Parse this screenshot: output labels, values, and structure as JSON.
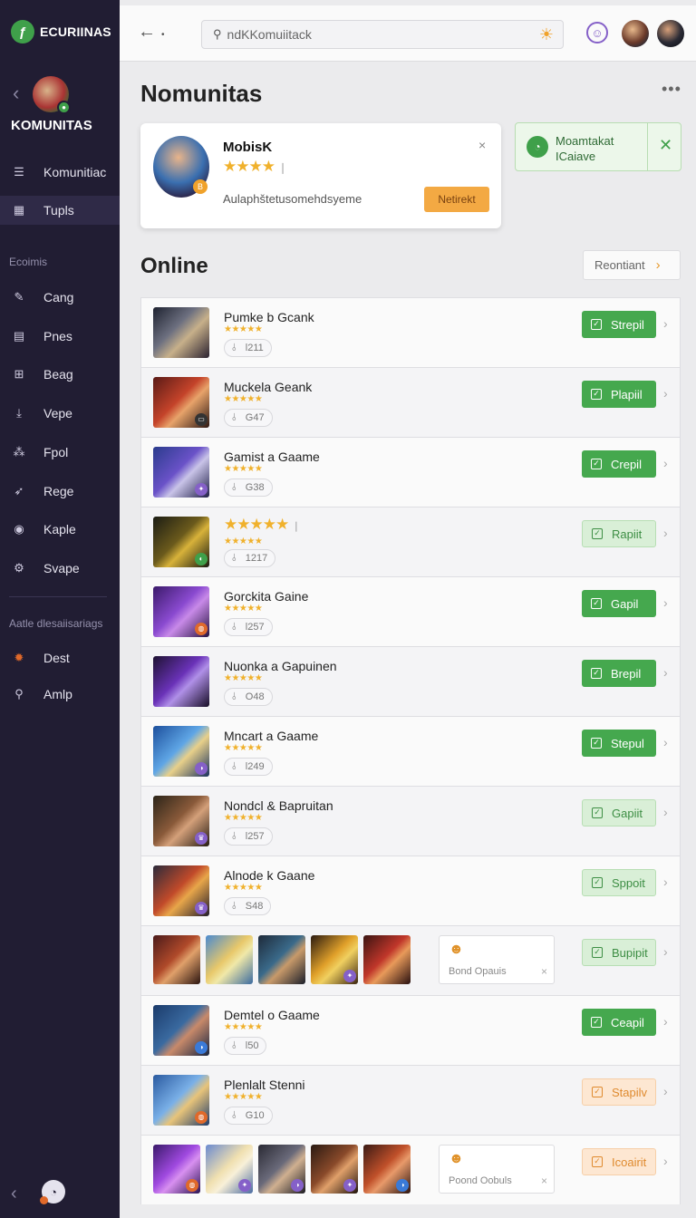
{
  "brand": {
    "logo_glyph": "ƒ",
    "name": "ECURIINAS"
  },
  "community": {
    "title": "KOMUNITAS"
  },
  "sidebar": {
    "items_top": [
      {
        "label": "Komunitiac",
        "icon": "list-icon",
        "glyph": "☰"
      },
      {
        "label": "Tupls",
        "icon": "grid-icon",
        "glyph": "▦",
        "active": true
      }
    ],
    "section1": "Ecoimis",
    "items_mid": [
      {
        "label": "Cang",
        "icon": "sword-icon",
        "glyph": "✎"
      },
      {
        "label": "Pnes",
        "icon": "doc-icon",
        "glyph": "▤"
      },
      {
        "label": "Beag",
        "icon": "box-icon",
        "glyph": "⊞"
      },
      {
        "label": "Vepe",
        "icon": "download-icon",
        "glyph": "⤓"
      },
      {
        "label": "Fpol",
        "icon": "group-icon",
        "glyph": "⁂"
      },
      {
        "label": "Rege",
        "icon": "wing-icon",
        "glyph": "➶"
      },
      {
        "label": "Kaple",
        "icon": "circle-icon",
        "glyph": "◉"
      },
      {
        "label": "Svape",
        "icon": "gear-icon",
        "glyph": "⚙"
      }
    ],
    "section2": "Aatle dlesaiisariags",
    "items_bottom": [
      {
        "label": "Dest",
        "icon": "orange-gear-icon",
        "glyph": "✹"
      },
      {
        "label": "Amlp",
        "icon": "search-icon",
        "glyph": "⚲"
      }
    ]
  },
  "topbar": {
    "search_value": "ndKKomuiitack",
    "search_glyph": "⚲",
    "sun_glyph": "☀",
    "smile_glyph": "☺"
  },
  "page": {
    "title": "Nomunitas",
    "more": "•••"
  },
  "featured": {
    "name": "MobisK",
    "stars": "★★★★",
    "half": "❘",
    "badge": "B",
    "desc": "Aulaphštetusomehdsyeme",
    "button": "Netirekt",
    "close": "×"
  },
  "toast": {
    "text": "Moamtakat ICaiave",
    "glyph": "◔",
    "close": "✕"
  },
  "online": {
    "title": "Online",
    "recent_button": "Reontiant",
    "recent_chev": "›"
  },
  "colors": {
    "green": "#45a84e",
    "orange": "#f3a943",
    "sidebar": "#211d33"
  },
  "rows": [
    {
      "type": "single",
      "title": "Pumke b Gcank",
      "stars": "★★★★★",
      "count": "Ɩ211",
      "action": "Strepil",
      "style": "green",
      "thumb": "linear-gradient(135deg,#1e2230,#6d7080 40%,#c7b08a 60%,#2a2230)",
      "badge": ""
    },
    {
      "type": "single",
      "title": "Muckela Geank",
      "stars": "★★★★★",
      "count": "G47",
      "action": "Plapiil",
      "style": "green",
      "thumb": "linear-gradient(135deg,#5a1a16,#c4432a 45%,#e8a36a 60%,#2b1612)",
      "badge": "▭",
      "badgeColor": "#333"
    },
    {
      "type": "single",
      "title": "Gamist a Gaame",
      "stars": "★★★★★",
      "count": "G38",
      "action": "Crepil",
      "style": "green",
      "thumb": "linear-gradient(135deg,#2a3b8c,#6a52c8 45%,#c9c4e8 60%,#1d1c45)",
      "badge": "✦",
      "badgeColor": "#8560c8"
    },
    {
      "type": "single",
      "big": true,
      "title": "",
      "stars": "★★★★★",
      "half": "❘",
      "count": "1217",
      "action": "Rapiit",
      "style": "light",
      "thumb": "linear-gradient(135deg,#1b1c14,#6b5a1c 45%,#d8b23a 60%,#15170f)",
      "badge": "◐",
      "badgeColor": "#3fa04a",
      "stars2": "★★★★★"
    },
    {
      "type": "single",
      "title": "Gorckita Gaine",
      "stars": "★★★★★",
      "count": "Ɩ257",
      "action": "Gapil",
      "style": "green",
      "thumb": "linear-gradient(135deg,#3b1a6a,#8a4ad0 45%,#c88ae8 60%,#24123e)",
      "badge": "◍",
      "badgeColor": "#e0692a"
    },
    {
      "type": "single",
      "title": "Nuonka a Gapuinen",
      "stars": "★★★★★",
      "count": "O48",
      "action": "Brepil",
      "style": "green",
      "thumb": "linear-gradient(135deg,#1e1232,#6a32b8 45%,#b090e8 60%,#170d26)",
      "badge": "",
      "badgeColor": ""
    },
    {
      "type": "single",
      "title": "Mncart a Gaame",
      "stars": "★★★★★",
      "count": "Ɩ249",
      "action": "Stepul",
      "style": "green",
      "thumb": "linear-gradient(135deg,#1c4f9c,#5fa6e6 45%,#e8d08a 60%,#17305e)",
      "badge": "◑",
      "badgeColor": "#8560c8"
    },
    {
      "type": "single",
      "title": "Nondcl & Bapruitan",
      "stars": "★★★★★",
      "count": "Ɩ257",
      "action": "Gapiit",
      "style": "light",
      "thumb": "linear-gradient(135deg,#2b2418,#8a5a3a 45%,#d4a07a 60%,#231a12)",
      "badge": "♛",
      "badgeColor": "#8560c8"
    },
    {
      "type": "single",
      "title": "Alnode k Gaane",
      "stars": "★★★★★",
      "count": "S48",
      "action": "Sppoit",
      "style": "light",
      "thumb": "linear-gradient(135deg,#2b2a3a,#c14a2a 45%,#e8a64a 60%,#1e1a2a)",
      "badge": "♛",
      "badgeColor": "#8560c8"
    },
    {
      "type": "multi",
      "action": "Bupipit",
      "style": "light",
      "card_text": "Bond Opauis",
      "card_glyph": "☻",
      "card_x": "×",
      "thumbs": [
        {
          "bg": "linear-gradient(135deg,#4a1a1a,#b04a2a 45%,#e0a06a 60%,#2a1410)",
          "badge": ""
        },
        {
          "bg": "linear-gradient(135deg,#4a8ad0,#e8c86a 45%,#f0e8a8 60%,#3a6aa0)",
          "badge": ""
        },
        {
          "bg": "linear-gradient(135deg,#1e2a3a,#3a6a8a 45%,#c89a6a 60%,#1a1e2a)",
          "badge": ""
        },
        {
          "bg": "linear-gradient(135deg,#2a1a10,#e0a02a 45%,#f0d060 60%,#3a2410)",
          "badge": "✦",
          "badgeColor": "#8560c8"
        },
        {
          "bg": "linear-gradient(135deg,#3a1412,#c0362a 45%,#e89a5a 60%,#281010)",
          "badge": ""
        }
      ]
    },
    {
      "type": "single",
      "title": "Demtel o Gaame",
      "stars": "★★★★★",
      "count": "Ɩ50",
      "action": "Ceapil",
      "style": "green",
      "thumb": "linear-gradient(135deg,#1a3a6a,#3a6aa0 45%,#c88a6a 60%,#162440)",
      "badge": "◑",
      "badgeColor": "#3a7ad8"
    },
    {
      "type": "single",
      "title": "Plenlalt Stenni",
      "stars": "★★★★★",
      "count": "G10",
      "action": "Stapilv",
      "style": "orange",
      "thumb": "linear-gradient(135deg,#2a5aa0,#7ab0e8 45%,#e8c47a 60%,#1e3a6a)",
      "badge": "◍",
      "badgeColor": "#e0692a"
    },
    {
      "type": "multi",
      "action": "Icoairit",
      "style": "orange",
      "card_text": "Poond Oobuls",
      "card_glyph": "☻",
      "card_x": "×",
      "thumbs": [
        {
          "bg": "linear-gradient(135deg,#3a1a6a,#a04ae0 45%,#d890f0 60%,#2a1250)",
          "badge": "◍",
          "badgeColor": "#e0692a"
        },
        {
          "bg": "linear-gradient(135deg,#6a8ad0,#f0e0b0 45%,#f8f0d8 60%,#4a6aa0)",
          "badge": "✦",
          "badgeColor": "#8560c8"
        },
        {
          "bg": "linear-gradient(135deg,#2a2a34,#6a6a7a 45%,#d0b090 60%,#1a1a22)",
          "badge": "◑",
          "badgeColor": "#8560c8"
        },
        {
          "bg": "linear-gradient(135deg,#2a1a12,#8a4a2a 45%,#e0a06a 60%,#1e120c)",
          "badge": "✦",
          "badgeColor": "#8560c8"
        },
        {
          "bg": "linear-gradient(135deg,#3a1a14,#c0502a 45%,#e89a6a 60%,#281210)",
          "badge": "◑",
          "badgeColor": "#3a7ad8"
        }
      ]
    }
  ]
}
